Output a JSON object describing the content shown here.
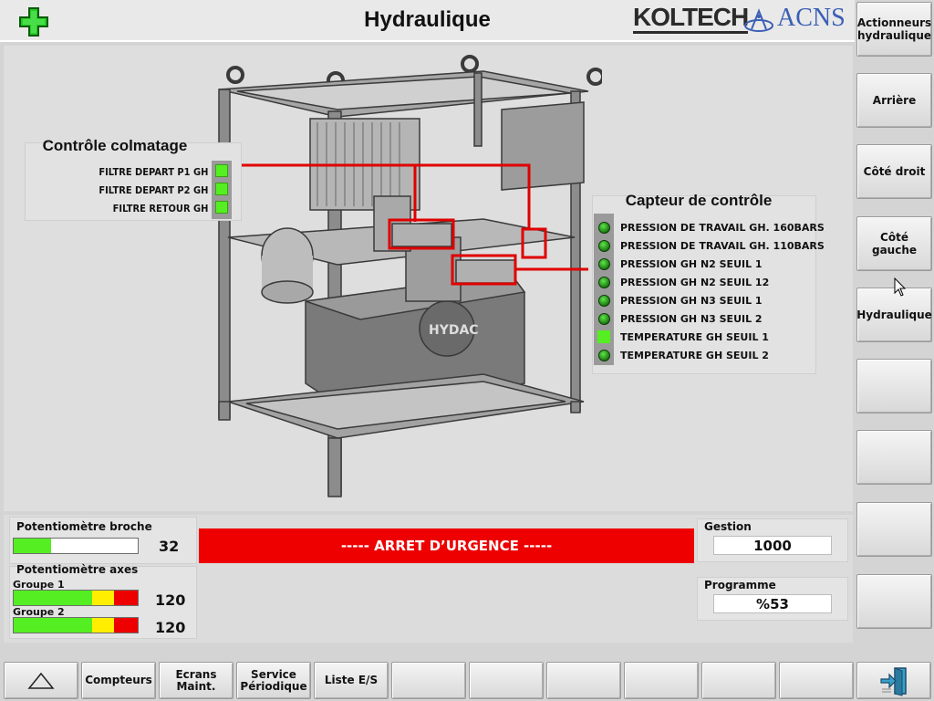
{
  "header": {
    "title": "Hydraulique",
    "logo_koltech": "KOLTECH",
    "logo_acns": "ACNS",
    "accent_green": "#22cc22"
  },
  "sidebar": {
    "items": [
      {
        "label": "Actionneurs\nhydraulique"
      },
      {
        "label": "Arrière"
      },
      {
        "label": "Côté droit"
      },
      {
        "label": "Côté gauche"
      },
      {
        "label": "Hydraulique"
      },
      {
        "label": ""
      },
      {
        "label": ""
      },
      {
        "label": ""
      },
      {
        "label": ""
      }
    ]
  },
  "colmatage": {
    "title": "Contrôle colmatage",
    "filters": [
      {
        "label": "FILTRE DEPART P1 GH"
      },
      {
        "label": "FILTRE DEPART P2 GH"
      },
      {
        "label": "FILTRE RETOUR GH"
      }
    ]
  },
  "capteur": {
    "title": "Capteur de contrôle",
    "sensors": [
      {
        "label": "PRESSION DE TRAVAIL GH. 160BARS",
        "indicator": "round"
      },
      {
        "label": "PRESSION DE TRAVAIL GH. 110BARS",
        "indicator": "round"
      },
      {
        "label": "PRESSION GH N2 SEUIL 1",
        "indicator": "round"
      },
      {
        "label": "PRESSION GH N2 SEUIL 12",
        "indicator": "round"
      },
      {
        "label": "PRESSION GH N3 SEUIL 1",
        "indicator": "round"
      },
      {
        "label": "PRESSION GH N3 SEUIL 2",
        "indicator": "round"
      },
      {
        "label": "TEMPERATURE GH SEUIL 1",
        "indicator": "square"
      },
      {
        "label": "TEMPERATURE GH SEUIL 2",
        "indicator": "round"
      }
    ]
  },
  "status": {
    "broche_label": "Potentiomètre broche",
    "broche_value": "32",
    "broche_fill_fraction": 0.3,
    "axes_label": "Potentiomètre axes",
    "groupe1_label": "Groupe 1",
    "groupe1_value": "120",
    "groupe2_label": "Groupe 2",
    "groupe2_value": "120",
    "emergency": "----- ARRET D’URGENCE -----",
    "gestion_label": "Gestion",
    "gestion_value": "1000",
    "programme_label": "Programme",
    "programme_value": "%53",
    "colors": {
      "green": "#55ee22",
      "yellow": "#ffee00",
      "red": "#ee0000"
    }
  },
  "toolbar": {
    "buttons": [
      {
        "label": ""
      },
      {
        "label": "Compteurs"
      },
      {
        "label": "Ecrans\nMaint."
      },
      {
        "label": "Service\nPériodique"
      },
      {
        "label": "Liste E/S"
      },
      {
        "label": ""
      },
      {
        "label": ""
      },
      {
        "label": ""
      },
      {
        "label": ""
      },
      {
        "label": ""
      },
      {
        "label": ""
      }
    ]
  }
}
